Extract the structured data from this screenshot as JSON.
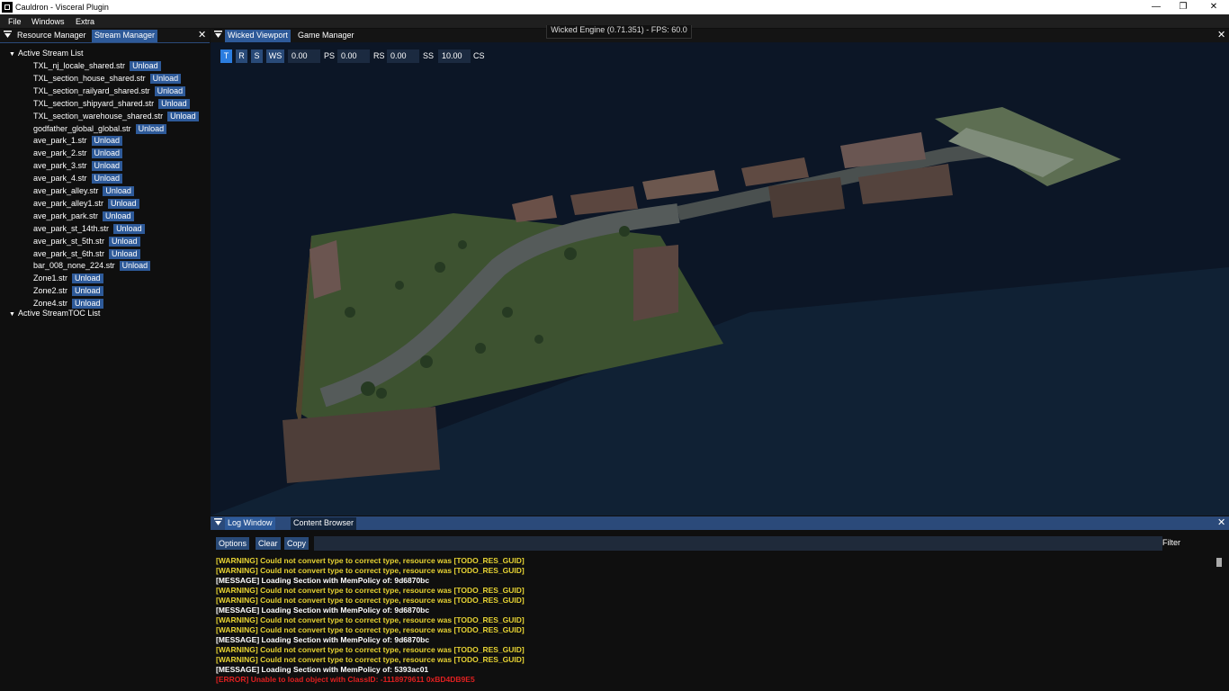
{
  "window": {
    "title": "Cauldron - Visceral Plugin",
    "controls": [
      "—",
      "❐",
      "✕"
    ]
  },
  "menu": [
    "File",
    "Windows",
    "Extra"
  ],
  "left_panel": {
    "tabs": [
      "Resource Manager",
      "Stream Manager"
    ],
    "active_tab": "Stream Manager",
    "close": "✕",
    "section1": "Active Stream List",
    "unload_label": "Unload",
    "streams": [
      "TXL_nj_locale_shared.str",
      "TXL_section_house_shared.str",
      "TXL_section_railyard_shared.str",
      "TXL_section_shipyard_shared.str",
      "TXL_section_warehouse_shared.str",
      "godfather_global_global.str",
      "ave_park_1.str",
      "ave_park_2.str",
      "ave_park_3.str",
      "ave_park_4.str",
      "ave_park_alley.str",
      "ave_park_alley1.str",
      "ave_park_park.str",
      "ave_park_st_14th.str",
      "ave_park_st_5th.str",
      "ave_park_st_6th.str",
      "bar_008_none_224.str",
      "Zone1.str",
      "Zone2.str",
      "Zone4.str"
    ],
    "section2": "Active StreamTOC List"
  },
  "viewport_panel": {
    "tabs": [
      "Wicked Viewport",
      "Game Manager"
    ],
    "active_tab": "Wicked Viewport",
    "close": "✕",
    "fps_overlay": "Wicked Engine (0.71.351) - FPS: 60.0",
    "toolbar": {
      "t": "T",
      "r": "R",
      "s": "S",
      "ws": "WS",
      "ws_value": "0.00",
      "ps": "PS",
      "ps_value": "0.00",
      "rs": "RS",
      "rs_value": "0.00",
      "ss": "SS",
      "ss_value": "10.00",
      "cs": "CS"
    }
  },
  "log_panel": {
    "tabs": [
      "Log Window",
      "Content Browser"
    ],
    "active_tab": "Log Window",
    "close": "✕",
    "buttons": [
      "Options",
      "Clear",
      "Copy"
    ],
    "filter_label": "Filter",
    "filter_value": "",
    "lines": [
      {
        "type": "warn",
        "text": "[WARNING] Could not convert type to correct type, resource was [TODO_RES_GUID]"
      },
      {
        "type": "warn",
        "text": "[WARNING] Could not convert type to correct type, resource was [TODO_RES_GUID]"
      },
      {
        "type": "msg",
        "text": "[MESSAGE] Loading Section with MemPolicy of: 9d6870bc"
      },
      {
        "type": "warn",
        "text": "[WARNING] Could not convert type to correct type, resource was [TODO_RES_GUID]"
      },
      {
        "type": "warn",
        "text": "[WARNING] Could not convert type to correct type, resource was [TODO_RES_GUID]"
      },
      {
        "type": "msg",
        "text": "[MESSAGE] Loading Section with MemPolicy of: 9d6870bc"
      },
      {
        "type": "warn",
        "text": "[WARNING] Could not convert type to correct type, resource was [TODO_RES_GUID]"
      },
      {
        "type": "warn",
        "text": "[WARNING] Could not convert type to correct type, resource was [TODO_RES_GUID]"
      },
      {
        "type": "msg",
        "text": "[MESSAGE] Loading Section with MemPolicy of: 9d6870bc"
      },
      {
        "type": "warn",
        "text": "[WARNING] Could not convert type to correct type, resource was [TODO_RES_GUID]"
      },
      {
        "type": "warn",
        "text": "[WARNING] Could not convert type to correct type, resource was [TODO_RES_GUID]"
      },
      {
        "type": "msg",
        "text": "[MESSAGE] Loading Section with MemPolicy of: 5393ac01"
      },
      {
        "type": "err",
        "text": "[ERROR] Unable to load object with ClassID: -1118979611 0xBD4DB9E5"
      }
    ]
  }
}
